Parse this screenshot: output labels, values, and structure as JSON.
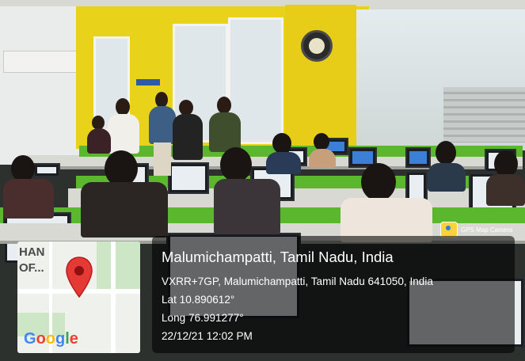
{
  "photo": {
    "description_icon": "computer-lab-photo"
  },
  "map": {
    "label": "HAN\nOF...",
    "pin_icon": "location-pin-icon",
    "logo_letters": [
      {
        "char": "G",
        "color": "#4285F4"
      },
      {
        "char": "o",
        "color": "#EA4335"
      },
      {
        "char": "o",
        "color": "#FBBC05"
      },
      {
        "char": "g",
        "color": "#4285F4"
      },
      {
        "char": "l",
        "color": "#34A853"
      },
      {
        "char": "e",
        "color": "#EA4335"
      }
    ]
  },
  "badge": {
    "label": "GPS Map Camera",
    "icon": "gps-map-camera-icon"
  },
  "location": {
    "title": "Malumichampatti, Tamil Nadu, India",
    "address": "VXRR+7GP, Malumichampatti, Tamil Nadu 641050, India",
    "lat": "Lat 10.890612°",
    "long": "Long 76.991277°",
    "datetime": "22/12/21 12:02 PM"
  },
  "colors": {
    "wall_accent": "#e8d21a",
    "desk_partition": "#5bb82e",
    "pin": "#e53935"
  }
}
